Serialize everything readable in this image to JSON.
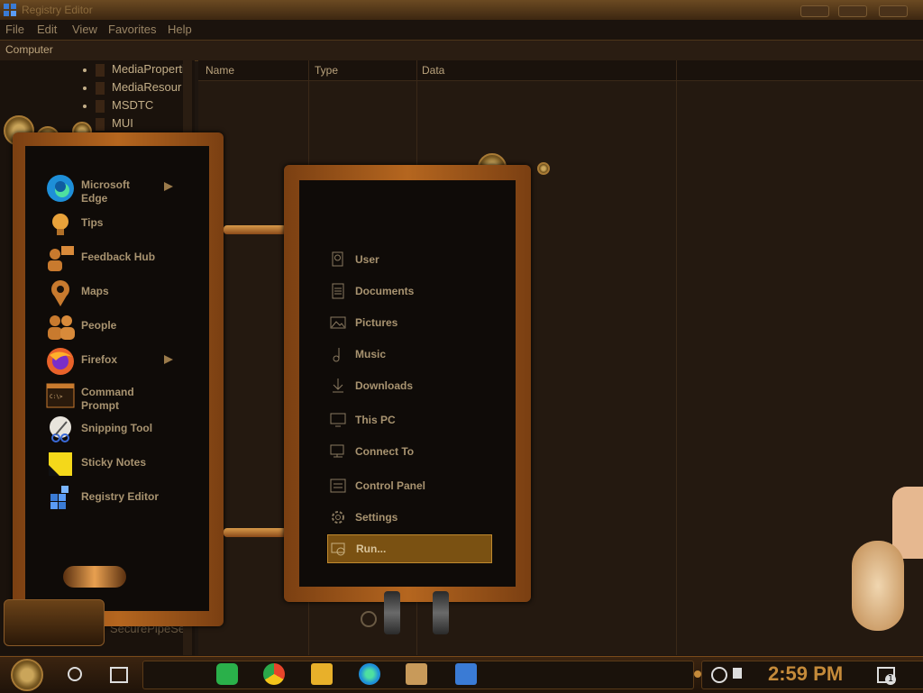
{
  "window": {
    "title": "Registry Editor"
  },
  "menu": {
    "items": [
      "File",
      "Edit",
      "View",
      "Favorites",
      "Help"
    ]
  },
  "address": {
    "path": "Computer"
  },
  "tree": {
    "items": [
      "MediaProperti",
      "MediaResour",
      "MSDTC",
      "MUI"
    ],
    "bottom_item": "SecurePipeSe"
  },
  "list": {
    "columns": {
      "name": "Name",
      "type": "Type",
      "data": "Data"
    }
  },
  "start_menu": {
    "apps": [
      {
        "label_l1": "Microsoft",
        "label_l2": "Edge",
        "has_submenu": true,
        "icon": "edge-icon"
      },
      {
        "label_l1": "Tips",
        "label_l2": "",
        "has_submenu": false,
        "icon": "lightbulb-icon"
      },
      {
        "label_l1": "Feedback Hub",
        "label_l2": "",
        "has_submenu": false,
        "icon": "feedback-icon"
      },
      {
        "label_l1": "Maps",
        "label_l2": "",
        "has_submenu": false,
        "icon": "map-pin-icon"
      },
      {
        "label_l1": "People",
        "label_l2": "",
        "has_submenu": false,
        "icon": "people-icon"
      },
      {
        "label_l1": "Firefox",
        "label_l2": "",
        "has_submenu": true,
        "icon": "firefox-icon"
      },
      {
        "label_l1": "Command",
        "label_l2": "Prompt",
        "has_submenu": false,
        "icon": "cmd-icon"
      },
      {
        "label_l1": "Snipping Tool",
        "label_l2": "",
        "has_submenu": false,
        "icon": "scissors-icon"
      },
      {
        "label_l1": "Sticky Notes",
        "label_l2": "",
        "has_submenu": false,
        "icon": "sticky-note-icon"
      },
      {
        "label_l1": "Registry Editor",
        "label_l2": "",
        "has_submenu": false,
        "icon": "registry-icon"
      }
    ],
    "places": [
      {
        "label": "User",
        "icon": "user-icon",
        "selected": false
      },
      {
        "label": "Documents",
        "icon": "document-icon",
        "selected": false
      },
      {
        "label": "Pictures",
        "icon": "picture-icon",
        "selected": false
      },
      {
        "label": "Music",
        "icon": "music-icon",
        "selected": false
      },
      {
        "label": "Downloads",
        "icon": "download-icon",
        "selected": false
      },
      {
        "label": "This PC",
        "icon": "monitor-icon",
        "selected": false
      },
      {
        "label": "Connect To",
        "icon": "connect-icon",
        "selected": false
      },
      {
        "label": "Control Panel",
        "icon": "control-panel-icon",
        "selected": false
      },
      {
        "label": "Settings",
        "icon": "gear-icon",
        "selected": false
      },
      {
        "label": "Run...",
        "icon": "run-icon",
        "selected": true
      }
    ]
  },
  "taskbar": {
    "clock": "2:59 PM",
    "notification_count": "1"
  },
  "colors": {
    "accent": "#c48a3a",
    "frame": "#b5661f",
    "selected": "#7a5112"
  }
}
